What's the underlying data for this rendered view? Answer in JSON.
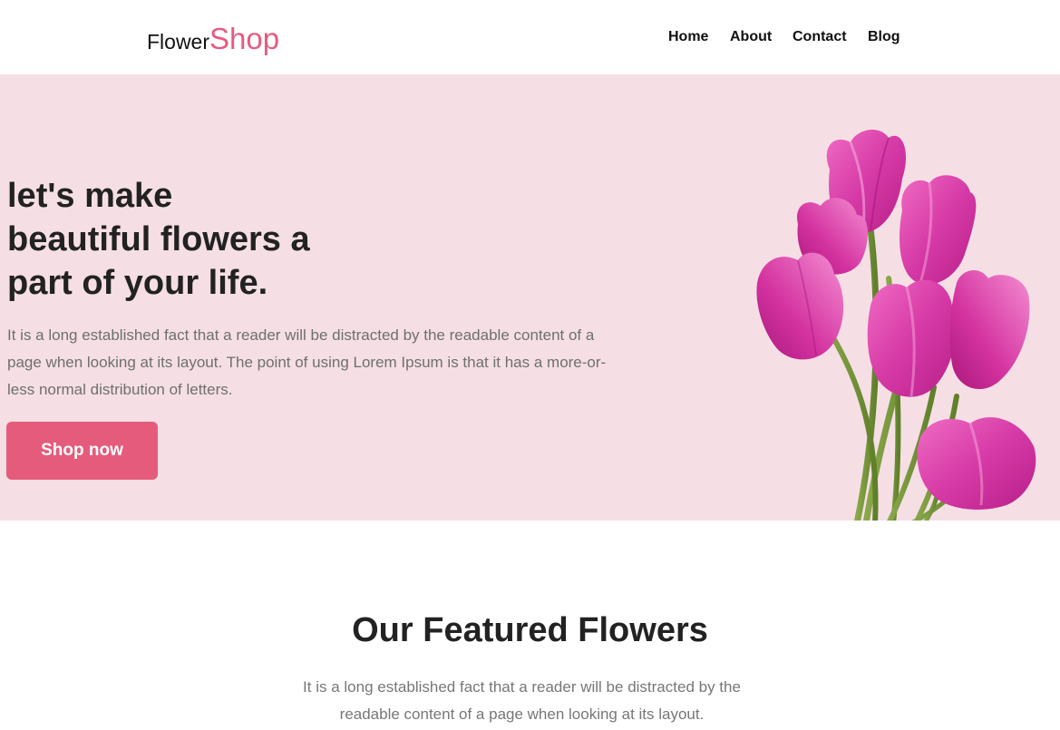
{
  "brand": {
    "name_main": "Flower",
    "name_accent": "Shop"
  },
  "nav": {
    "items": [
      "Home",
      "About",
      "Contact",
      "Blog"
    ]
  },
  "hero": {
    "title_lines": [
      "let's make",
      "beautiful flowers a",
      "part of your life."
    ],
    "description": "It is a long established fact that a reader will be distracted by the readable content of a page when looking at its layout. The point of using Lorem Ipsum is that it has a more-or-less normal distribution of letters.",
    "button_label": "Shop now",
    "image": "pink-tulip-bouquet"
  },
  "featured": {
    "title": "Our Featured Flowers",
    "description": "It is a long established fact that a reader will be distracted by the readable content of a page when looking at its layout."
  },
  "colors": {
    "accent": "#e55b7b",
    "hero_background": "#f5dfe4",
    "heading": "#222222",
    "body_text": "#6f6f6f"
  }
}
